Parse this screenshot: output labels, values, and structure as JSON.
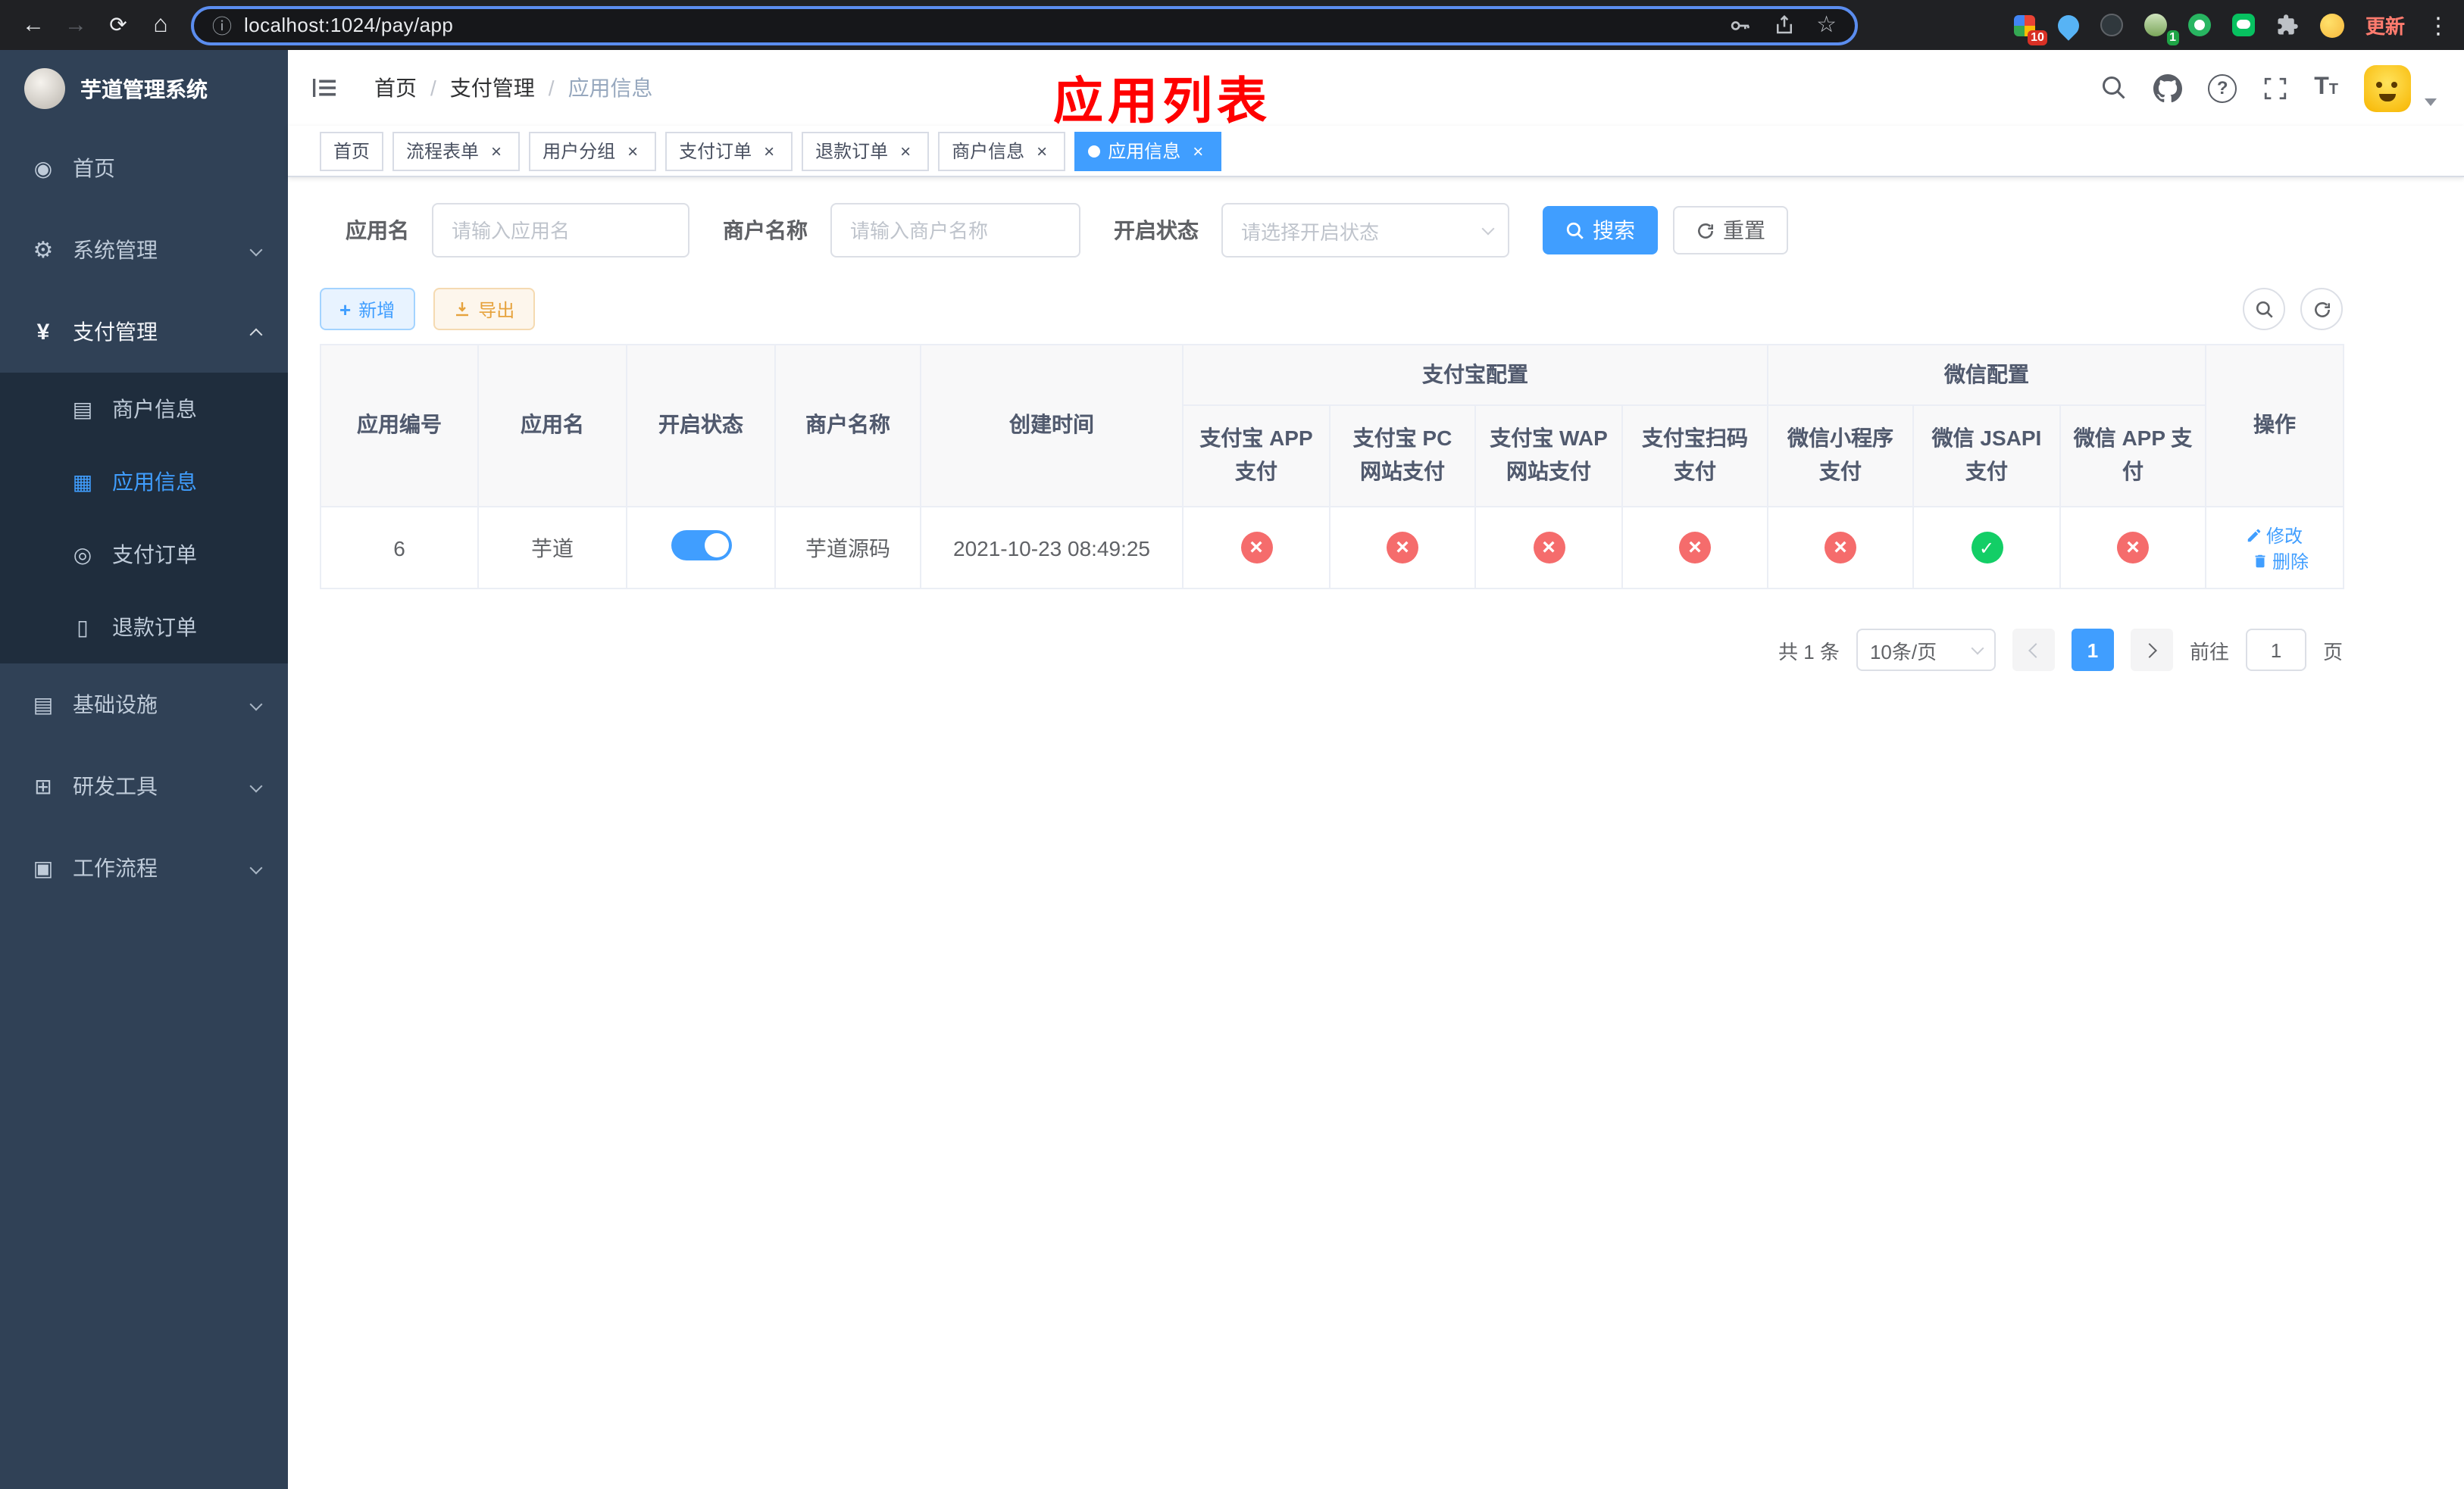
{
  "browser": {
    "url": "localhost:1024/pay/app",
    "update_label": "更新",
    "badges": {
      "extensions": "10",
      "profile": "1"
    }
  },
  "sidebar": {
    "title": "芋道管理系统",
    "menu": [
      {
        "label": "首页"
      },
      {
        "label": "系统管理"
      },
      {
        "label": "支付管理"
      },
      {
        "label": "基础设施"
      },
      {
        "label": "研发工具"
      },
      {
        "label": "工作流程"
      }
    ],
    "submenu": [
      {
        "label": "商户信息"
      },
      {
        "label": "应用信息"
      },
      {
        "label": "支付订单"
      },
      {
        "label": "退款订单"
      }
    ]
  },
  "navbar": {
    "breadcrumb": [
      "首页",
      "支付管理",
      "应用信息"
    ],
    "annotation": "应用列表"
  },
  "tabs": [
    {
      "label": "首页"
    },
    {
      "label": "流程表单"
    },
    {
      "label": "用户分组"
    },
    {
      "label": "支付订单"
    },
    {
      "label": "退款订单"
    },
    {
      "label": "商户信息"
    },
    {
      "label": "应用信息"
    }
  ],
  "filters": {
    "app_name_label": "应用名",
    "app_name_placeholder": "请输入应用名",
    "merchant_label": "商户名称",
    "merchant_placeholder": "请输入商户名称",
    "status_label": "开启状态",
    "status_placeholder": "请选择开启状态",
    "search_label": "搜索",
    "reset_label": "重置"
  },
  "toolbar": {
    "add_label": "新增",
    "export_label": "导出"
  },
  "table": {
    "headers": {
      "app_id": "应用编号",
      "app_name": "应用名",
      "status": "开启状态",
      "merchant": "商户名称",
      "create_time": "创建时间",
      "alipay_group": "支付宝配置",
      "wechat_group": "微信配置",
      "alipay_app": "支付宝 APP 支付",
      "alipay_pc": "支付宝 PC 网站支付",
      "alipay_wap": "支付宝 WAP 网站支付",
      "alipay_qr": "支付宝扫码支付",
      "wx_mini": "微信小程序支付",
      "wx_jsapi": "微信 JSAPI 支付",
      "wx_app": "微信 APP 支付",
      "actions": "操作"
    },
    "rows": [
      {
        "app_id": "6",
        "app_name": "芋道",
        "enabled": true,
        "merchant": "芋道源码",
        "create_time": "2021-10-23 08:49:25",
        "alipay_app": "fail",
        "alipay_pc": "fail",
        "alipay_wap": "fail",
        "alipay_qr": "fail",
        "wx_mini": "fail",
        "wx_jsapi": "success",
        "wx_app": "fail",
        "edit_label": "修改",
        "delete_label": "删除"
      }
    ]
  },
  "pagination": {
    "total_label": "共 1 条",
    "page_size_label": "10条/页",
    "page": "1",
    "goto_label": "前往",
    "goto_value": "1",
    "unit_label": "页"
  }
}
